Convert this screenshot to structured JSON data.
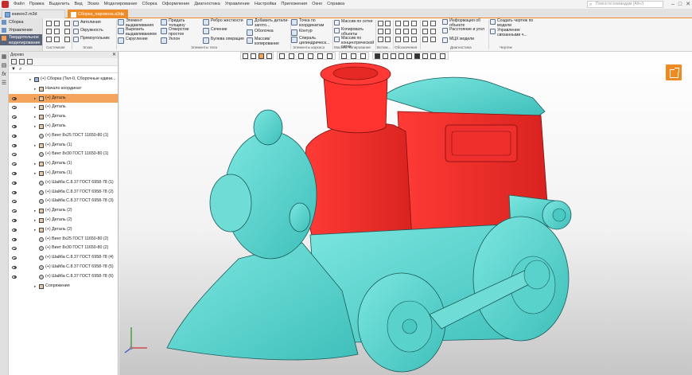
{
  "menu": [
    "Файл",
    "Правка",
    "Выделить",
    "Вид",
    "Эскиз",
    "Моделирование",
    "Сборка",
    "Оформление",
    "Диагностика",
    "Управление",
    "Настройка",
    "Приложения",
    "Окно",
    "Справка"
  ],
  "search": {
    "placeholder": "Поиск по командам (Alt+/)"
  },
  "tabs": [
    {
      "label": "кникоv2.m3d",
      "active": false
    },
    {
      "label": "Сборка_паровоза.a3d",
      "active": true
    }
  ],
  "ribbon": {
    "left_tabs": [
      "Сборка",
      "Управление",
      "Твердотельное моделирование"
    ],
    "sketch_group": {
      "items": [
        "Автолиния",
        "Окружность",
        "Прямоугольник"
      ],
      "label": "Эскиз",
      "sub_label": "Системная"
    },
    "body_group": {
      "items": [
        "Элемент выдавливания",
        "Вырезать выдавливанием",
        "Скругление",
        "Придать толщину",
        "Отверстие простое",
        "Уклон",
        "Ребро жесткости",
        "Сечение",
        "Булева операция",
        "Добавить детали-загото...",
        "Оболочка",
        "Массив/копирование"
      ],
      "label": "Элементы тела"
    },
    "frame_group": {
      "items": [
        "Точка по координатам",
        "Контур",
        "Спираль цилиндрическ..."
      ],
      "label": "Элементы каркаса"
    },
    "array_group": {
      "items": [
        "Массив по сетке",
        "Копировать объекты",
        "Массив по концентрической сетке"
      ],
      "label": "Массив, копирование"
    },
    "aux_label": "Вспом...",
    "mark_label": "Обозначения",
    "diag_group": {
      "items": [
        "Информация об объекте",
        "Расстояние и угол",
        "МЦХ модели"
      ],
      "label": "Диагностика"
    },
    "drawing_group": {
      "items": [
        "Создать чертеж по модели",
        "Управление связанными ч..."
      ],
      "label": "Чертеж"
    }
  },
  "tree": {
    "header": "Дерево",
    "rows": [
      {
        "text": "(+) Сборка (Тел-0, Сборочные едини...",
        "icon": "assembly",
        "level": 0,
        "selected": false
      },
      {
        "text": "Начало координат",
        "icon": "origin",
        "level": 1,
        "selected": false
      },
      {
        "text": "(+) Деталь",
        "icon": "part",
        "level": 1,
        "selected": true
      },
      {
        "text": "(+) Деталь",
        "icon": "part",
        "level": 1,
        "selected": false
      },
      {
        "text": "(+) Деталь",
        "icon": "part",
        "level": 1,
        "selected": false
      },
      {
        "text": "(+) Деталь",
        "icon": "part",
        "level": 1,
        "selected": false
      },
      {
        "text": "(+) Винт 8x25 ГОСТ 11650-80 (1)",
        "icon": "screw",
        "level": 1,
        "selected": false
      },
      {
        "text": "(+) Деталь (1)",
        "icon": "part",
        "level": 1,
        "selected": false
      },
      {
        "text": "(+) Винт 8x30 ГОСТ 11650-80 (1)",
        "icon": "screw",
        "level": 1,
        "selected": false
      },
      {
        "text": "(+) Деталь (1)",
        "icon": "part",
        "level": 1,
        "selected": false
      },
      {
        "text": "(+) Деталь (1)",
        "icon": "part",
        "level": 1,
        "selected": false
      },
      {
        "text": "(+) Шайба C.8.37 ГОСТ 6958-78 (1)",
        "icon": "screw",
        "level": 1,
        "selected": false
      },
      {
        "text": "(+) Шайба C.8.37 ГОСТ 6958-78 (2)",
        "icon": "screw",
        "level": 1,
        "selected": false
      },
      {
        "text": "(+) Шайба C.8.37 ГОСТ 6958-78 (3)",
        "icon": "screw",
        "level": 1,
        "selected": false
      },
      {
        "text": "(+) Деталь (2)",
        "icon": "part",
        "level": 1,
        "selected": false
      },
      {
        "text": "(+) Деталь (2)",
        "icon": "part",
        "level": 1,
        "selected": false
      },
      {
        "text": "(+) Деталь (2)",
        "icon": "part",
        "level": 1,
        "selected": false
      },
      {
        "text": "(+) Винт 8x25 ГОСТ 11650-80 (2)",
        "icon": "screw",
        "level": 1,
        "selected": false
      },
      {
        "text": "(+) Винт 8x30 ГОСТ 11650-80 (2)",
        "icon": "screw",
        "level": 1,
        "selected": false
      },
      {
        "text": "(+) Шайба C.8.37 ГОСТ 6958-78 (4)",
        "icon": "screw",
        "level": 1,
        "selected": false
      },
      {
        "text": "(+) Шайба C.8.37 ГОСТ 6958-78 (5)",
        "icon": "screw",
        "level": 1,
        "selected": false
      },
      {
        "text": "(+) Шайба C.8.37 ГОСТ 6958-78 (6)",
        "icon": "screw",
        "level": 1,
        "selected": false
      },
      {
        "text": "Сопряжения",
        "icon": "mates",
        "level": 1,
        "selected": false
      }
    ]
  },
  "colors": {
    "accent": "#f08a24",
    "model_red": "#f2302e",
    "model_cyan": "#5fd6d0",
    "selection": "#f5a55b"
  }
}
